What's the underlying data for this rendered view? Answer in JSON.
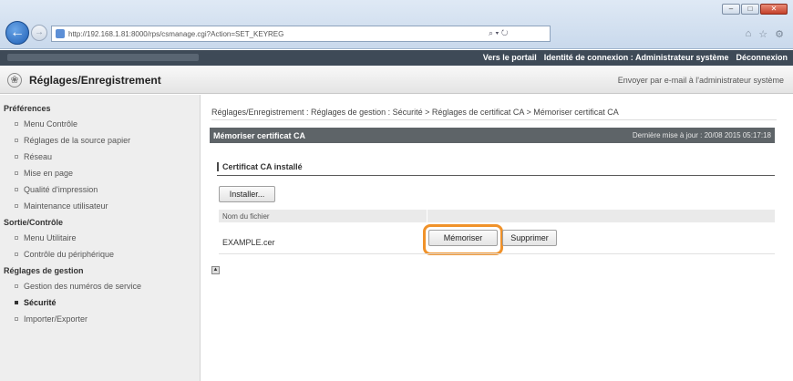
{
  "browser": {
    "url": "http://192.168.1.81:8000/rps/csmanage.cgi?Action=SET_KEYREG",
    "search_glyph": "⌕ ▾ ↻",
    "window_buttons": [
      "–",
      "□",
      "✕"
    ],
    "toolbar_icons": [
      "⌂",
      "☆",
      "⚙"
    ]
  },
  "topbar": {
    "portal_link": "Vers le portail",
    "login_identity": "Identité de connexion : Administrateur système",
    "logout_link": "Déconnexion"
  },
  "header": {
    "title": "Réglages/Enregistrement",
    "email_admin_link": "Envoyer par e-mail à l'administrateur système"
  },
  "sidebar": {
    "sections": [
      {
        "title": "Préférences",
        "items": [
          {
            "label": "Menu Contrôle"
          },
          {
            "label": "Réglages de la source papier"
          },
          {
            "label": "Réseau"
          },
          {
            "label": "Mise en page"
          },
          {
            "label": "Qualité d'impression"
          },
          {
            "label": "Maintenance utilisateur"
          }
        ]
      },
      {
        "title": "Sortie/Contrôle",
        "items": [
          {
            "label": "Menu Utilitaire"
          },
          {
            "label": "Contrôle du périphérique"
          }
        ]
      },
      {
        "title": "Réglages de gestion",
        "items": [
          {
            "label": "Gestion des numéros de service"
          },
          {
            "label": "Sécurité"
          },
          {
            "label": "Importer/Exporter"
          }
        ]
      }
    ]
  },
  "main": {
    "breadcrumb": "Réglages/Enregistrement : Réglages de gestion : Sécurité > Réglages de certificat CA > Mémoriser certificat CA",
    "panel_title": "Mémoriser certificat CA",
    "last_update": "Dernière mise à jour : 20/08 2015 05:17:18",
    "section_title": "Certificat CA installé",
    "install_button": "Installer...",
    "table_header_filename": "Nom du fichier",
    "file_name": "EXAMPLE.cer",
    "store_button": "Mémoriser",
    "delete_button": "Supprimer"
  }
}
